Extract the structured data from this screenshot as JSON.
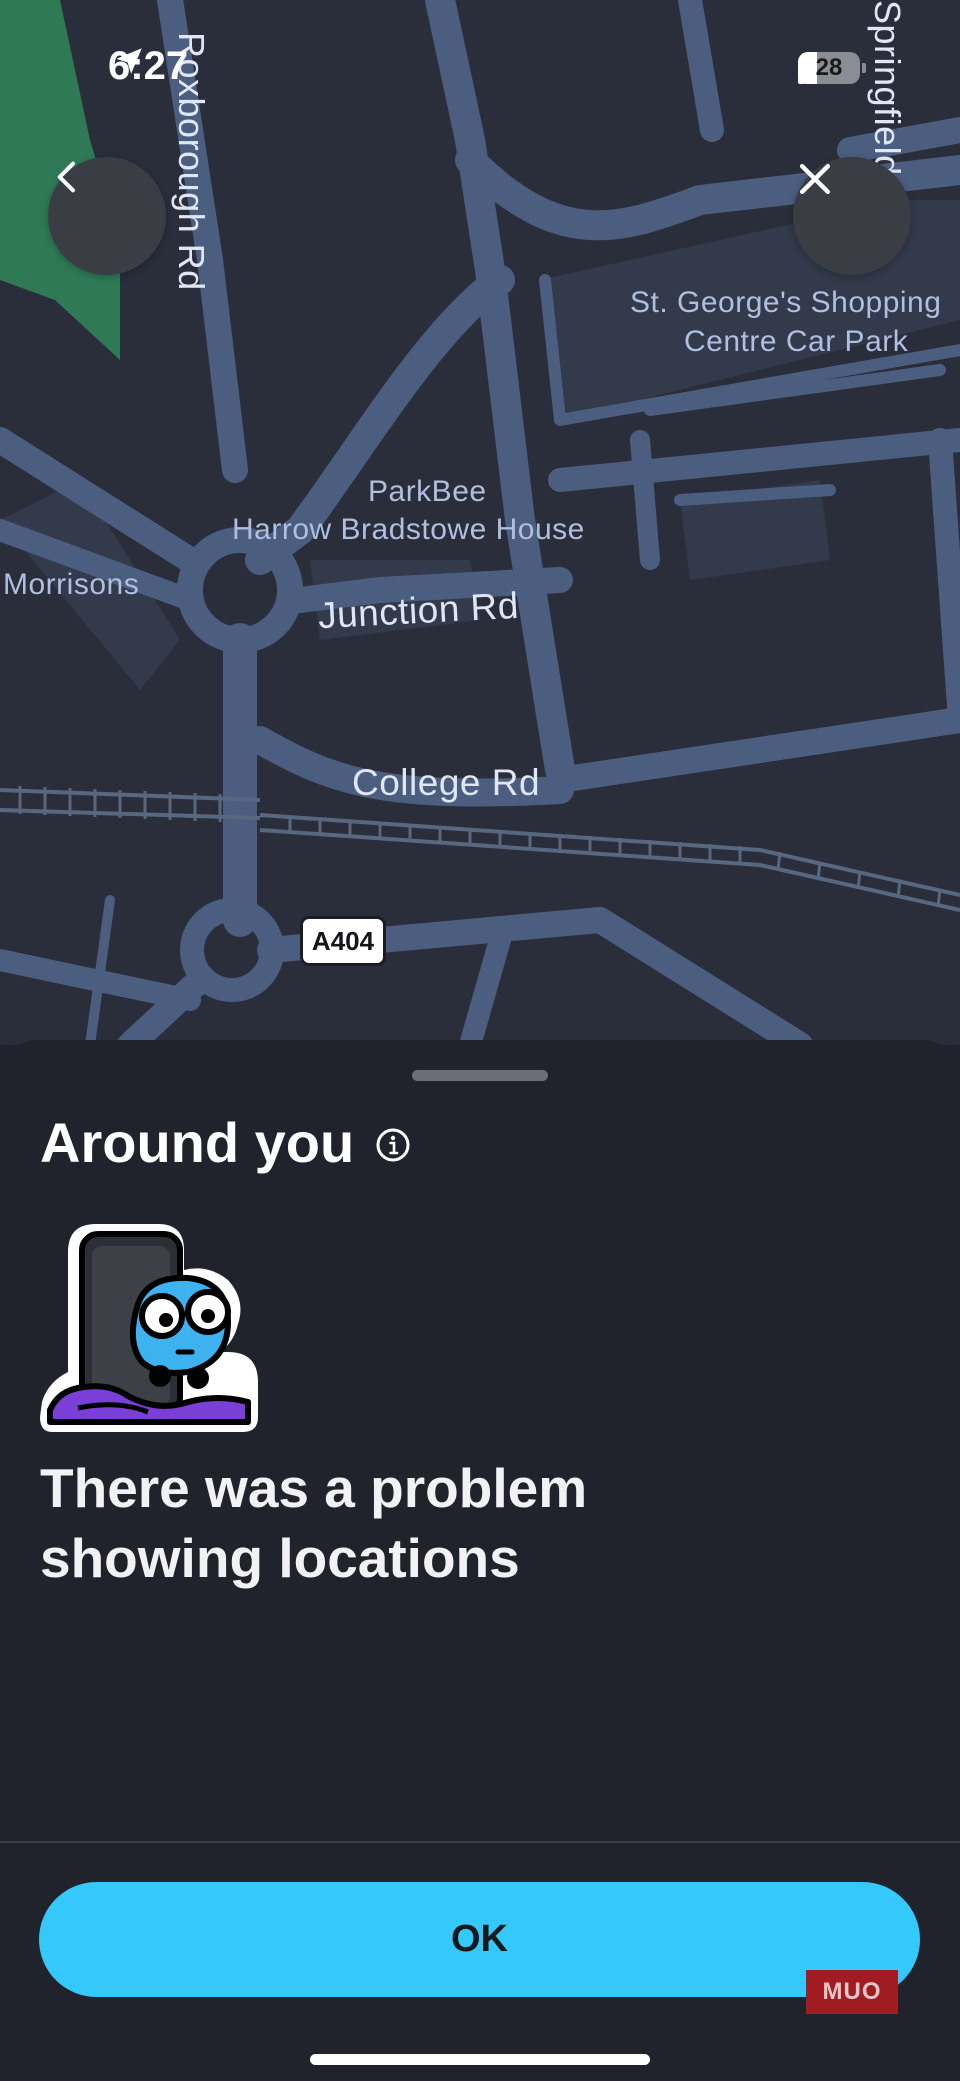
{
  "status_bar": {
    "time": "6:27",
    "battery_level": "28"
  },
  "map": {
    "labels": {
      "roxborough_rd": "Roxborough Rd",
      "springfield": "Springfield",
      "st_george_line1": "St. George's Shopping",
      "st_george_line2": "Centre Car Park",
      "parkbee_line1": "ParkBee",
      "parkbee_line2": "Harrow Bradstowe House",
      "morrisons": "Morrisons",
      "junction_rd": "Junction Rd",
      "college_rd": "College Rd",
      "a404": "A404"
    }
  },
  "sheet": {
    "title": "Around you",
    "error_message": "There was a problem showing locations",
    "ok_label": "OK",
    "watermark": "MUO"
  },
  "colors": {
    "accent": "#35c8fb",
    "sheet_background": "#20232c",
    "map_background": "#2a2e3a",
    "park_green": "#2f7a55"
  },
  "icons": [
    "back-chevron-icon",
    "close-icon",
    "info-icon",
    "location-arrow-icon",
    "signal-icon",
    "battery-icon"
  ]
}
